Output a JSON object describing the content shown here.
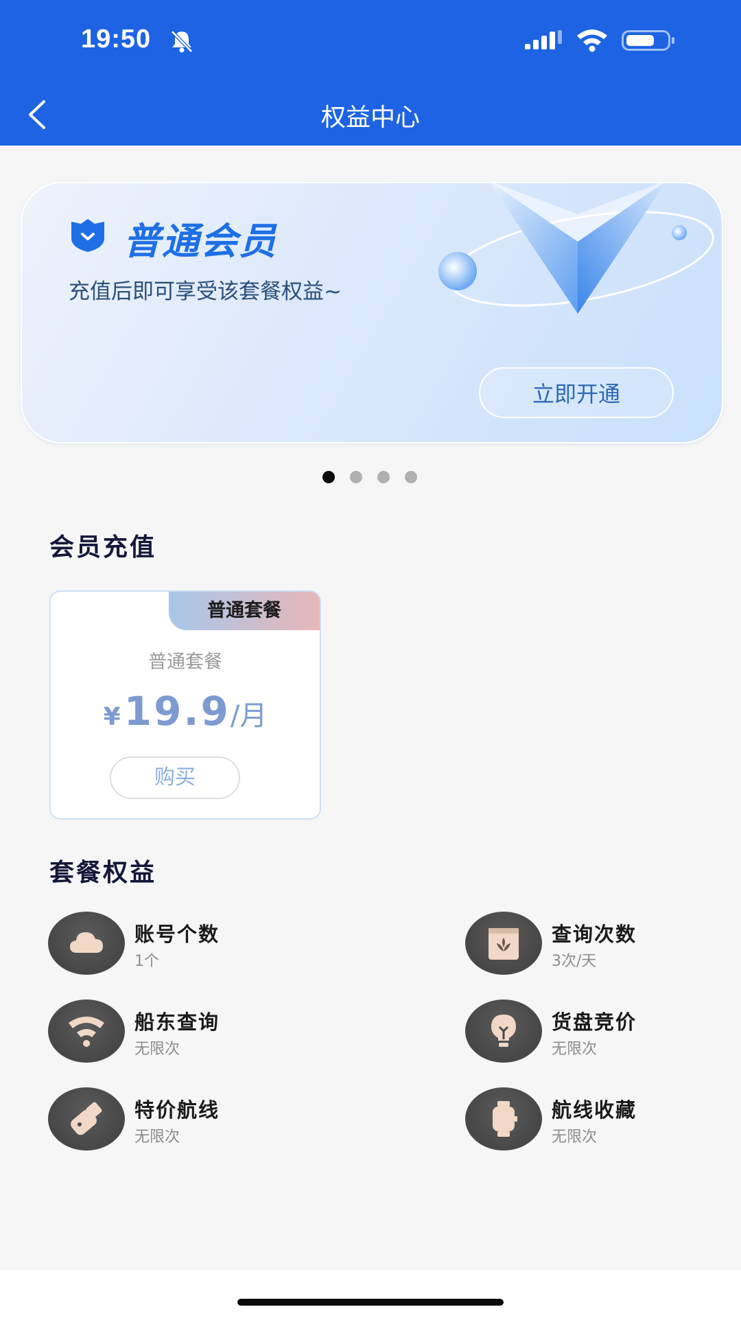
{
  "status": {
    "time": "19:50"
  },
  "nav": {
    "title": "权益中心"
  },
  "banner": {
    "title": "普通会员",
    "subtitle": "充值后即可享受该套餐权益~",
    "button": "立即开通"
  },
  "carousel": {
    "count": 4,
    "active": 0
  },
  "recharge": {
    "title": "会员充值",
    "plan": {
      "tag": "普通套餐",
      "name": "普通套餐",
      "currency": "¥",
      "price": "19.9",
      "unit": "/月",
      "buy": "购买"
    }
  },
  "benefits": {
    "title": "套餐权益",
    "items": [
      {
        "name": "账号个数",
        "value": "1个",
        "icon": "cloud-icon"
      },
      {
        "name": "查询次数",
        "value": "3次/天",
        "icon": "book-icon"
      },
      {
        "name": "船东查询",
        "value": "无限次",
        "icon": "wifi-signal-icon"
      },
      {
        "name": "货盘竞价",
        "value": "无限次",
        "icon": "lightbulb-icon"
      },
      {
        "name": "特价航线",
        "value": "无限次",
        "icon": "usb-drive-icon"
      },
      {
        "name": "航线收藏",
        "value": "无限次",
        "icon": "watch-icon"
      }
    ]
  },
  "colors": {
    "header": "#1d63e3",
    "accent": "#1e6fe6",
    "icon_fill": "#f1d8c6"
  }
}
